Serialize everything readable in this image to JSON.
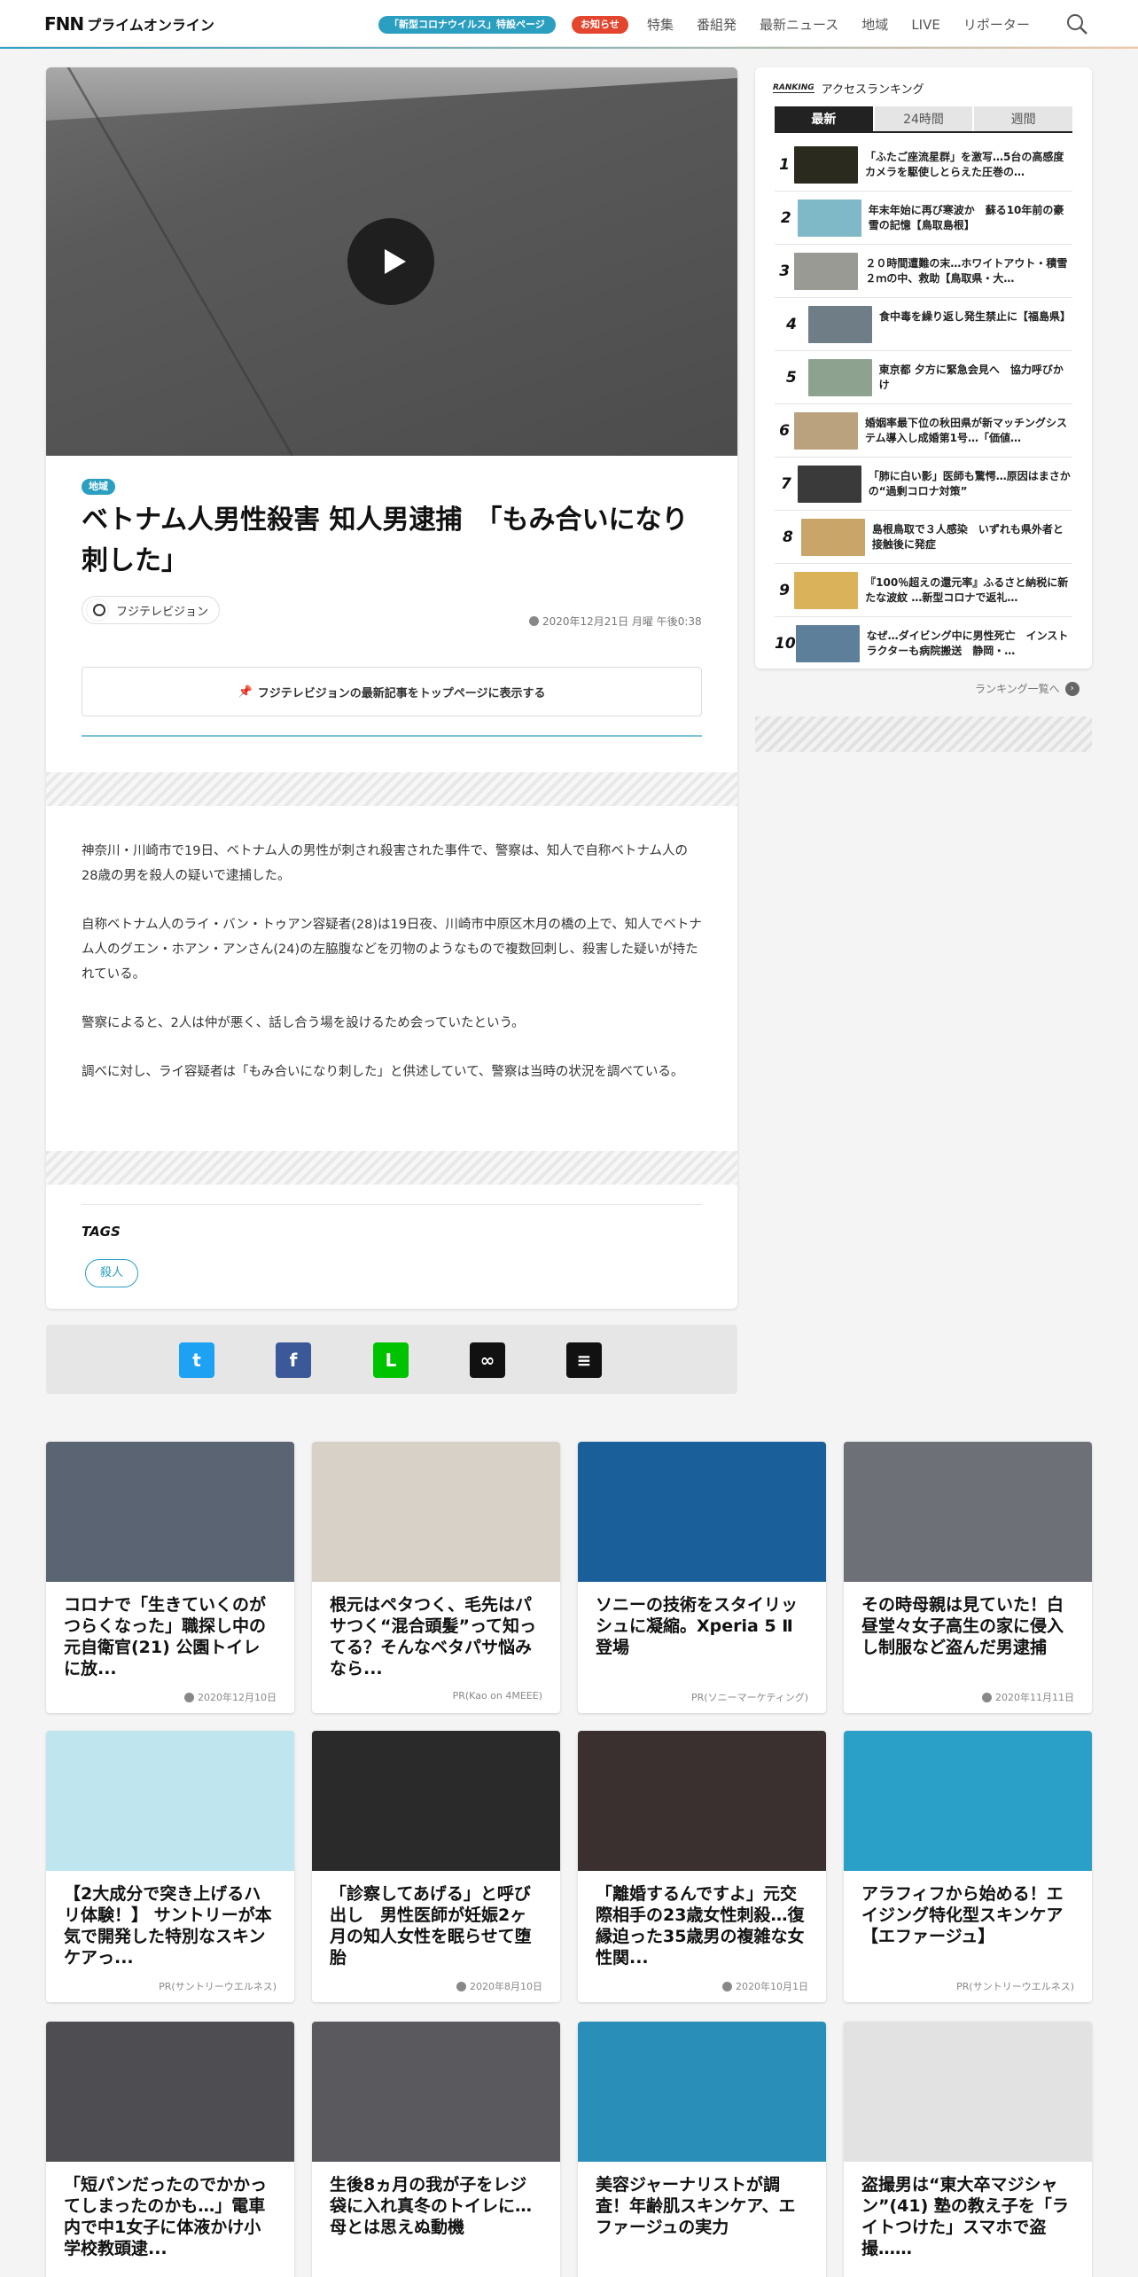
{
  "header": {
    "logo_mark": "FNN",
    "logo_word": "プライムオンライン",
    "corona_label": "「新型コロナウイルス」特設ページ",
    "notice_label": "お知らせ",
    "nav": [
      "特集",
      "番組発",
      "最新ニュース",
      "地域",
      "LIVE",
      "リポーター"
    ]
  },
  "article": {
    "category": "地域",
    "headline": "ベトナム人男性殺害 知人男逮捕　「もみ合いになり刺した」",
    "source": "フジテレビジョン",
    "date": "2020年12月21日 月曜 午後0:38",
    "pin_label": "フジテレビジョンの最新記事をトップページに表示する",
    "paragraphs": [
      "神奈川・川崎市で19日、ベトナム人の男性が刺され殺害された事件で、警察は、知人で自称ベトナム人の28歳の男を殺人の疑いで逮捕した。",
      "自称ベトナム人のライ・バン・トゥアン容疑者(28)は19日夜、川崎市中原区木月の橋の上で、知人でベトナム人のグエン・ホアン・アンさん(24)の左脇腹などを刃物のようなもので複数回刺し、殺害した疑いが持たれている。",
      "警察によると、2人は仲が悪く、話し合う場を設けるため会っていたという。",
      "調べに対し、ライ容疑者は「もみ合いになり刺した」と供述していて、警察は当時の状況を調べている。"
    ],
    "tags_title": "TAGS",
    "tags": [
      "殺人"
    ]
  },
  "share": [
    {
      "icon": "twitter-icon",
      "glyph": "t",
      "color": "#1da1f2"
    },
    {
      "icon": "facebook-icon",
      "glyph": "f",
      "color": "#3b5998"
    },
    {
      "icon": "line-icon",
      "glyph": "L",
      "color": "#00c300"
    },
    {
      "icon": "link-icon",
      "glyph": "∞",
      "color": "#111111"
    },
    {
      "icon": "comment-icon",
      "glyph": "≡",
      "color": "#111111"
    }
  ],
  "ranking": {
    "heading_en": "RANKING",
    "heading": "アクセスランキング",
    "tabs": [
      "最新",
      "24時間",
      "週間"
    ],
    "items": [
      {
        "num": "1",
        "text": "「ふたご座流星群」を激写…5台の高感度カメラを駆使しとらえた圧巻の…",
        "color": "#2b2a1e"
      },
      {
        "num": "2",
        "text": "年末年始に再び寒波か　蘇る10年前の豪雪の記憶【鳥取島根】",
        "color": "#7fb9c8"
      },
      {
        "num": "3",
        "text": "２０時間遭難の末…ホワイトアウト・積雪２ｍの中、救助【鳥取県・大…",
        "color": "#9a9a94"
      },
      {
        "num": "4",
        "text": "食中毒を繰り返し発生禁止に【福島県】",
        "color": "#6f7d87"
      },
      {
        "num": "5",
        "text": "東京都 夕方に緊急会見へ　協力呼びかけ",
        "color": "#8da38f"
      },
      {
        "num": "6",
        "text": "婚姻率最下位の秋田県が新マッチングシステム導入し成婚第1号…「価値…",
        "color": "#b9a27d"
      },
      {
        "num": "7",
        "text": "「肺に白い影」医師も驚愕…原因はまさかの“過剰コロナ対策”",
        "color": "#3a3a3a"
      },
      {
        "num": "8",
        "text": "島根鳥取で３人感染　いずれも県外者と接触後に発症",
        "color": "#c9a56a"
      },
      {
        "num": "9",
        "text": "『100％超えの還元率』ふるさと納税に新たな波紋 …新型コロナで返礼…",
        "color": "#d9b25a"
      },
      {
        "num": "10",
        "text": "なぜ…ダイビング中に男性死亡　インストラクターも病院搬送　静岡・…",
        "color": "#5d7f9a"
      }
    ],
    "more_label": "ランキング一覧へ"
  },
  "recommend": [
    {
      "title": "コロナで「生きていくのがつらくなった」職探し中の元自衛官(21) 公園トイレに放...",
      "meta": "2020年12月10日",
      "clock": true,
      "color": "#5b6472"
    },
    {
      "title": "根元はペタつく、毛先はパサつく“混合頭髪”って知ってる？そんなベタパサ悩みなら...",
      "meta": "PR(Kao on 4MEEE)",
      "clock": false,
      "color": "#d8d1c8"
    },
    {
      "title": "ソニーの技術をスタイリッシュに凝縮。Xperia 5 Ⅱ 登場",
      "meta": "PR(ソニーマーケティング)",
      "clock": false,
      "color": "#1a5f9a"
    },
    {
      "title": "その時母親は見ていた！白昼堂々女子高生の家に侵入し制服など盗んだ男逮捕",
      "meta": "2020年11月11日",
      "clock": true,
      "color": "#6e7077"
    },
    {
      "title": "【2大成分で突き上げるハリ体験！】 サントリーが本気で開発した特別なスキンケアっ...",
      "meta": "PR(サントリーウエルネス)",
      "clock": false,
      "color": "#bfe6ee"
    },
    {
      "title": "「診察してあげる」と呼び出し　男性医師が妊娠2ヶ月の知人女性を眠らせて堕胎",
      "meta": "2020年8月10日",
      "clock": true,
      "color": "#2a2a2a"
    },
    {
      "title": "「離婚するんですよ」元交際相手の23歳女性刺殺…復縁迫った35歳男の複雑な女性関...",
      "meta": "2020年10月1日",
      "clock": true,
      "color": "#3a3030"
    },
    {
      "title": "アラフィフから始める！エイジング特化型スキンケア【エファージュ】",
      "meta": "PR(サントリーウエルネス)",
      "clock": false,
      "color": "#2aa0c8"
    },
    {
      "title": "「短パンだったのでかかってしまったのかも…」電車内で中1女子に体液かけ小学校教頭逮...",
      "meta": "",
      "clock": false,
      "color": "#4d4d52"
    },
    {
      "title": "生後8ヵ月の我が子をレジ袋に入れ真冬のトイレに…母とは思えぬ動機",
      "meta": "",
      "clock": false,
      "color": "#5a5a5e"
    },
    {
      "title": "美容ジャーナリストが調査！年齢肌スキンケア、エファージュの実力",
      "meta": "",
      "clock": false,
      "color": "#2a8fb8"
    },
    {
      "title": "盗撮男は“東大卒マジシャン”(41) 塾の教え子を「ライトつけた」スマホで盗撮……",
      "meta": "",
      "clock": false,
      "color": "#e2e2e2"
    }
  ]
}
